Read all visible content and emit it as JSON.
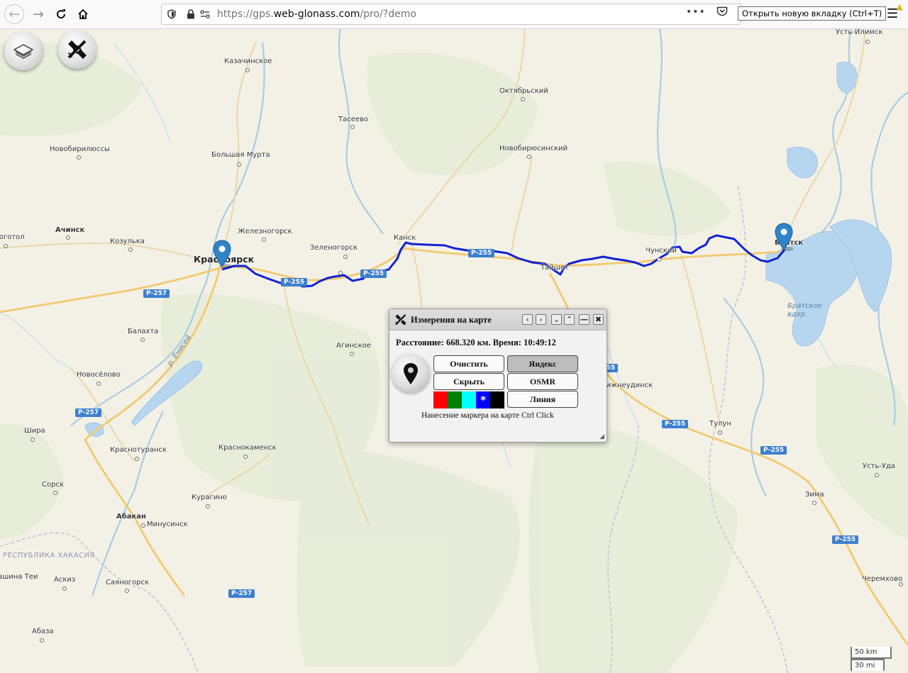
{
  "browser": {
    "url_prefix": "https://gps.",
    "url_domain": "web-glonass.com",
    "url_path": "/pro/?demo",
    "tooltip": "Открыть новую вкладку (Ctrl+T)",
    "icons": {
      "back": "arrow-left-icon",
      "forward": "arrow-right-icon",
      "reload": "reload-icon",
      "home": "home-icon",
      "shield": "shield-icon",
      "lock": "lock-icon",
      "page_actions": "more-dots-icon",
      "pocket": "pocket-icon",
      "bookmark": "star-icon",
      "menu": "hamburger-menu-icon",
      "warning": "warning-icon"
    }
  },
  "map": {
    "tools": {
      "layers": "layers-icon",
      "measure": "ruler-satellite-icon"
    },
    "route_color": "#0f22d6",
    "cities": [
      {
        "id": "ust-ilimsk",
        "name": "Усть-Илимск"
      },
      {
        "id": "kazachinskoe",
        "name": "Казачинское"
      },
      {
        "id": "oktyabrsky",
        "name": "Октябрьский"
      },
      {
        "id": "taseevo",
        "name": "Тасеево"
      },
      {
        "id": "novobirilyussy",
        "name": "Новобирилюссы"
      },
      {
        "id": "bolshaya-murta",
        "name": "Большая Мурта"
      },
      {
        "id": "novobiryusinsky",
        "name": "Новобирюсинский"
      },
      {
        "id": "achinsk",
        "name": "Ачинск"
      },
      {
        "id": "bogotol",
        "name": "Боготол"
      },
      {
        "id": "zheleznogorsk",
        "name": "Железногорск"
      },
      {
        "id": "kozulka",
        "name": "Козулька"
      },
      {
        "id": "krasnoyarsk",
        "name": "Красноярск"
      },
      {
        "id": "zelenogorsk",
        "name": "Зеленогорск"
      },
      {
        "id": "kansk",
        "name": "Канск"
      },
      {
        "id": "chunsky",
        "name": "Чунский"
      },
      {
        "id": "bratsk",
        "name": "Братск"
      },
      {
        "id": "tayshet",
        "name": "Тайшет"
      },
      {
        "id": "balakhta",
        "name": "Балахта"
      },
      {
        "id": "aginskoe",
        "name": "Агинское"
      },
      {
        "id": "novoselovo",
        "name": "Новосёлово"
      },
      {
        "id": "nizhneudinsk",
        "name": "Нижнеудинск"
      },
      {
        "id": "shira",
        "name": "Шира"
      },
      {
        "id": "krasnoturansk",
        "name": "Краснотуранск"
      },
      {
        "id": "krasnokamensk",
        "name": "Краснокаменск"
      },
      {
        "id": "tulun",
        "name": "Тулун"
      },
      {
        "id": "sorsk",
        "name": "Сорск"
      },
      {
        "id": "ust-uda",
        "name": "Усть-Уда"
      },
      {
        "id": "kuragino",
        "name": "Курагино"
      },
      {
        "id": "zima",
        "name": "Зима"
      },
      {
        "id": "abakan",
        "name": "Абакан"
      },
      {
        "id": "minusinsk",
        "name": "Минусинск"
      },
      {
        "id": "askiz",
        "name": "Аскиз"
      },
      {
        "id": "sayanogorsk",
        "name": "Саяногорск"
      },
      {
        "id": "tashtyp",
        "name": "ашина Теи"
      },
      {
        "id": "cheremkhovo",
        "name": "Черемхово"
      },
      {
        "id": "abaza",
        "name": "Абаза"
      }
    ],
    "region_label": "РЕСПУБЛИКА ХАКАСИЯ",
    "water_labels": {
      "yenisei": "р. Енисей",
      "bratsk_reservoir": "Братское вдхр."
    },
    "roads": {
      "r257": "Р-257",
      "r255": "Р-255"
    },
    "scale": {
      "metric": "50 km",
      "imperial": "30 mi"
    }
  },
  "dialog": {
    "title": "Измерения на карте",
    "title_icon": "ruler-satellite-icon",
    "controls": [
      "‹",
      "›",
      "⌄",
      "⌃",
      "—",
      "✖"
    ],
    "info": "Расстояние: 668.320 км. Время: 10:49:12",
    "buttons": {
      "clear": "Очистить",
      "yandex": "Яндекс",
      "hide": "Скрыть",
      "osmr": "OSMR",
      "line": "Линия"
    },
    "colors": [
      "#ff0000",
      "#008000",
      "#00ffff",
      "#0000ff",
      "#000000"
    ],
    "selected_color_mark": "*",
    "hint": "Нанесение маркера на карте Ctrl Click",
    "marker_icon": "map-pin-icon",
    "resize_icon": "resize-grip-icon"
  }
}
